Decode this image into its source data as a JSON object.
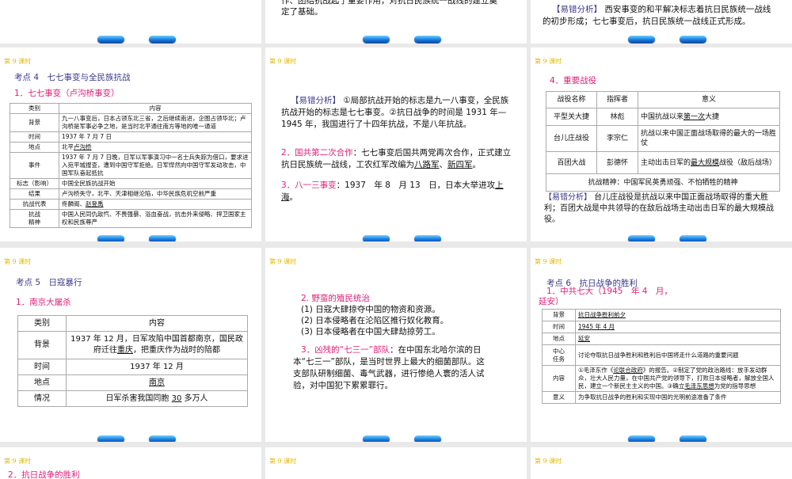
{
  "header": "第 9 课时",
  "s_top_mid": {
    "line1": "作、团结抗战起了重要作用，对抗日民族统一战线的建立奠",
    "line2": "定了基础。"
  },
  "s_top_right": {
    "tag": "【易错分析】",
    "text": " 西安事变的和平解决标志着抗日民族统一战线的初步形成；七七事变后，抗日民族统一战线正式形成。"
  },
  "s4": {
    "title": "考点 4　七七事变与全民族抗战",
    "sub": "1．七七事变（卢沟桥事变）",
    "head": [
      "类别",
      "内容"
    ],
    "rows": [
      [
        "背景",
        "九一八事变后，日本占领东北三省，之后继续南进，企图占领华北；卢沟桥是军事必争之地，是当时北平通往南方等地的唯一通道"
      ],
      [
        "时间",
        "1937 年 7 月 7 日"
      ],
      [
        "地点",
        "北平",
        "卢沟桥"
      ],
      [
        "事件",
        "1937 年 7 月 7 日晚，日军以军事演习中一名士兵失踪为借口，要求进入宛平城搜查，遭到中国守军拒绝。日军悍然向中国守军发动攻击，中国军队奋起抵抗"
      ],
      [
        "标志（影响）",
        "中国全民族抗战开始"
      ],
      [
        "结果",
        "卢沟桥失守，北平、天津相继沦陷，中华民族危机空前严重"
      ],
      [
        "抗战代表",
        "佟麟阁、",
        "赵登禹"
      ],
      [
        "抗战\n精神",
        "中国人民同仇敌忾、不畏强暴、浴血奋战，抗击外来侵略、捍卫国家主权和民族尊严"
      ]
    ]
  },
  "s_mid": {
    "tag": "【易错分析】",
    "p1": " ①局部抗战开始的标志是九一八事变，全民族抗战开始的标志是七七事变。②抗日战争的时间是 1931 年—1945 年，我国进行了十四年抗战，不是八年抗战。",
    "i2_label": "2．国共第二次合作",
    "i2_text": "：七七事变后国共两党再次合作，正式建立抗日民族统一战线，工农红军改编为",
    "i2_u1": "八路军",
    "i2_sep": "、",
    "i2_u2": "新四军",
    "i2_end": "。",
    "i3_label": "3．八一三事变",
    "i3_text": "：1937　年 8　月 13　日，日本大举进攻",
    "i3_u": "上海",
    "i3_end": "。"
  },
  "s_battle": {
    "sub": "4．重要战役",
    "head": [
      "战役名称",
      "指挥者",
      "意义"
    ],
    "rows": [
      [
        "平型关大捷",
        "林彪",
        "中国抗战以来",
        "第一次",
        "大捷"
      ],
      [
        "台儿庄战役",
        "李宗仁",
        "抗战以来中国正面战场取得的最大的一场胜仗",
        "",
        ""
      ],
      [
        "百团大战",
        "彭德怀",
        "主动出击日军的",
        "最大规模",
        "战役（敌后战场）"
      ]
    ],
    "spirit": "抗战精神：中国军民英勇顽强、不怕牺牲的精神",
    "tag": "【易错分析】",
    "text": " 台儿庄战役是抗战以来中国正面战场取得的重大胜利；百团大战是中共领导的在敌后战场主动出击日军的最大规模战役。"
  },
  "s5": {
    "title": "考点 5　日寇暴行",
    "sub": "1．南京大屠杀",
    "head": [
      "类别",
      "内容"
    ],
    "rows": [
      [
        "背景",
        "1937 年 12 月，日军攻陷中国首都南京，国民政府迁往",
        "重庆",
        "，把重庆作为战时的陪都"
      ],
      [
        "时间",
        "1937 年 12 月"
      ],
      [
        "地点",
        "南京"
      ],
      [
        "情况",
        "日军杀害我国同胞 ",
        "30",
        " 多万人"
      ]
    ]
  },
  "s_crime": {
    "i2": "2. 野蛮的殖民统治",
    "l1": "(1) 日寇大肆掠夺中国的物资和资源。",
    "l2": "(2) 日本侵略者在沦陷区推行奴化教育。",
    "l3": "(3) 日本侵略者在中国大肆劫掠劳工。",
    "i3_label": "3．凶残的“七三一”部队",
    "i3_text": "：在中国东北哈尔滨的日本“七三一”部队，是当时世界上最大的细菌部队。这支部队研制细菌、毒气武器，进行惨绝人寰的活人试验，对中国犯下累累罪行。"
  },
  "s6": {
    "title": "考点 6　抗日战争的胜利",
    "sub": "1．中共七大（1945　年 4　月，延安）",
    "rows": [
      [
        "背景",
        "抗日战争胜利前夕"
      ],
      [
        "时间",
        "1945 年 4 月"
      ],
      [
        "地点",
        "延安"
      ],
      [
        "中心\n任务",
        "讨论夺取抗日战争胜利和胜利后中国将走什么道路的重要问题"
      ],
      [
        "内容",
        "①毛泽东作《",
        "论联合政府",
        "》的报告。②制定了党的政治路线：放手发动群众，壮大人民力量，在中国共产党的领导下，打败日本侵略者，解放全国人民，建立一个新民主主义的中国。③确立",
        "毛泽东思想",
        "为党的指导思想"
      ],
      [
        "意义",
        "为争取抗日战争的胜利和实现中国的光明前途准备了条件"
      ]
    ]
  },
  "s_bottom_left": {
    "sub": "2．抗日战争的胜利"
  }
}
